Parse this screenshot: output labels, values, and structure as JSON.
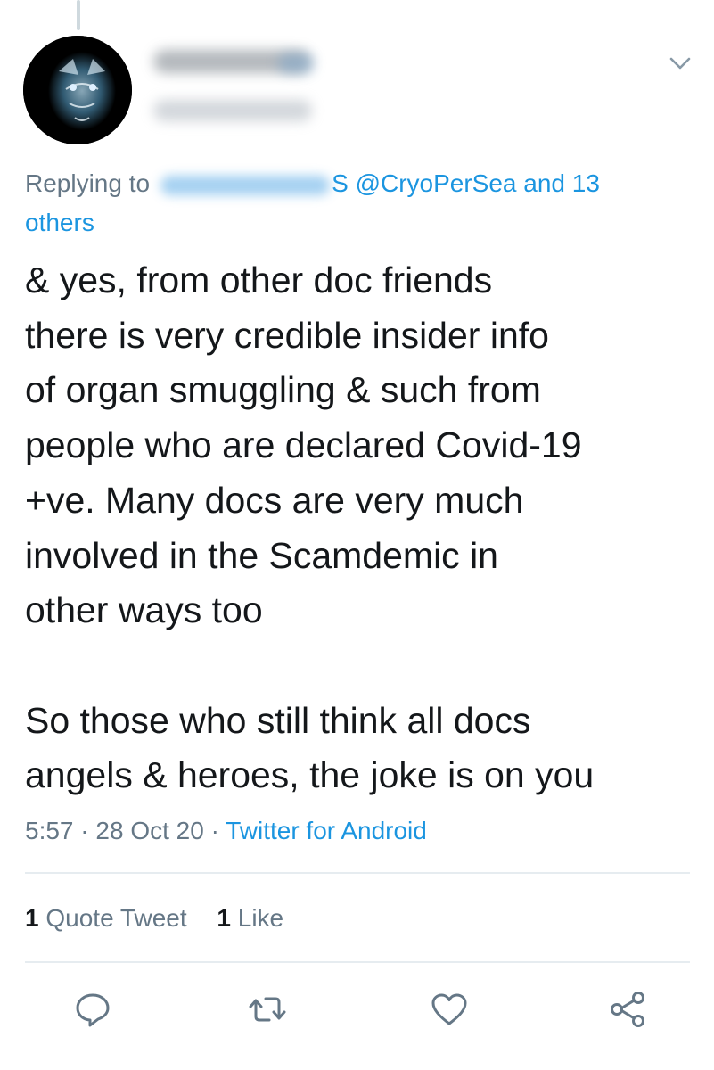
{
  "tweet": {
    "reply_prefix": "Replying to",
    "reply_partial_char": "S",
    "reply_mention": "@CryoPerSea",
    "reply_and": "and 13",
    "reply_others": "others",
    "body": "& yes, from other doc friends\nthere is very credible insider info\nof organ smuggling & such from\npeople who are declared Covid-19\n+ve. Many docs are very much\ninvolved in the Scamdemic in\nother ways too\n\nSo those who still think all docs\nangels & heroes, the joke is on you",
    "time": "5:57",
    "separator": "·",
    "date": "28 Oct 20",
    "source": "Twitter for Android"
  },
  "stats": {
    "quote_count": "1",
    "quote_label": "Quote Tweet",
    "like_count": "1",
    "like_label": "Like"
  },
  "icons": {
    "more": "chevron-down-icon",
    "reply": "reply-icon",
    "retweet": "retweet-icon",
    "like": "heart-icon",
    "share": "share-icon"
  },
  "colors": {
    "link": "#1b95e0",
    "secondary_text": "#657786",
    "primary_text": "#14171a",
    "divider": "#e6ecf0"
  }
}
